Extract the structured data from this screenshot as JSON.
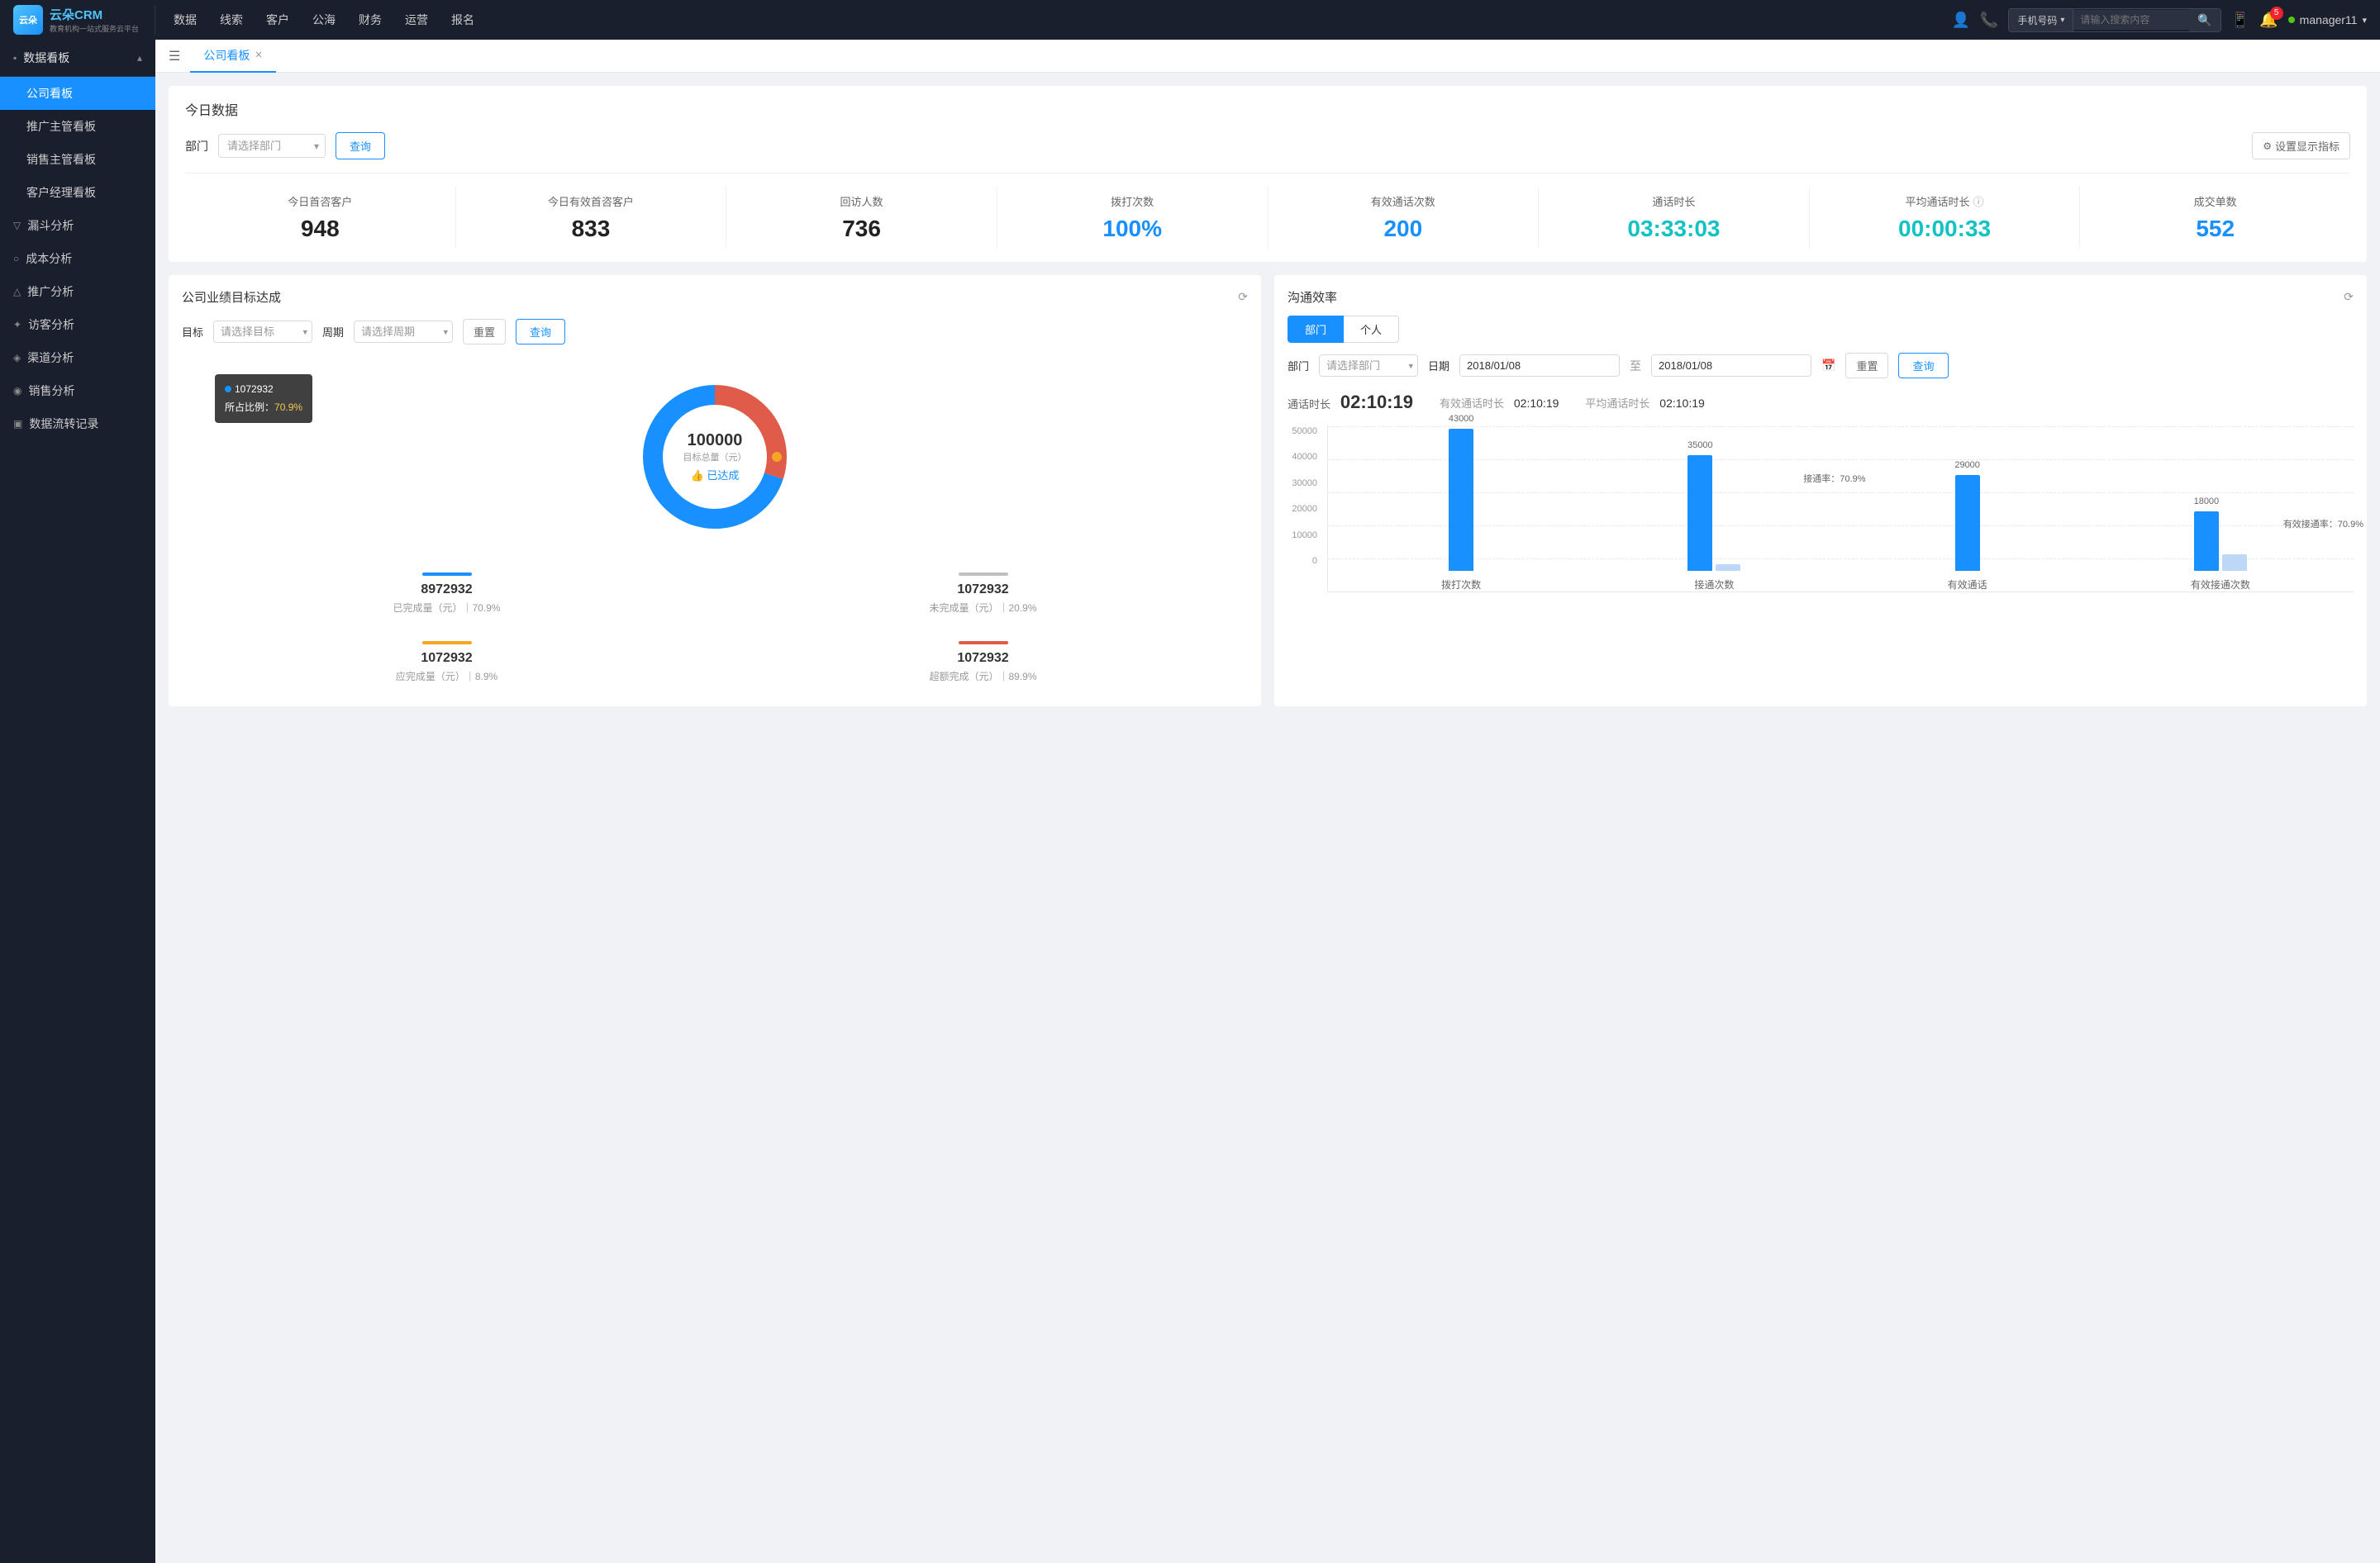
{
  "topNav": {
    "brand": "云朵CRM",
    "brandSub": "教育机构一站式服务云平台",
    "items": [
      "数据",
      "线索",
      "客户",
      "公海",
      "财务",
      "运营",
      "报名"
    ],
    "searchPlaceholder": "请输入搜索内容",
    "searchSelectLabel": "手机号码",
    "notificationCount": "5",
    "username": "manager11"
  },
  "sidebar": {
    "sectionLabel": "数据看板",
    "activeItem": "公司看板",
    "items": [
      "公司看板",
      "推广主管看板",
      "销售主管看板",
      "客户经理看板"
    ],
    "groups": [
      {
        "icon": "▽",
        "label": "漏斗分析"
      },
      {
        "icon": "○",
        "label": "成本分析"
      },
      {
        "icon": "△",
        "label": "推广分析"
      },
      {
        "icon": "✦",
        "label": "访客分析"
      },
      {
        "icon": "◈",
        "label": "渠道分析"
      },
      {
        "icon": "◉",
        "label": "销售分析"
      },
      {
        "icon": "▣",
        "label": "数据流转记录"
      }
    ]
  },
  "tabs": [
    {
      "label": "公司看板",
      "closable": true,
      "active": true
    }
  ],
  "todayData": {
    "title": "今日数据",
    "filterLabel": "部门",
    "filterPlaceholder": "请选择部门",
    "queryBtn": "查询",
    "settingsBtn": "设置显示指标",
    "metrics": [
      {
        "label": "今日首咨客户",
        "value": "948",
        "colorClass": "dark"
      },
      {
        "label": "今日有效首咨客户",
        "value": "833",
        "colorClass": "dark"
      },
      {
        "label": "回访人数",
        "value": "736",
        "colorClass": "dark"
      },
      {
        "label": "拨打次数",
        "value": "100%",
        "colorClass": "blue"
      },
      {
        "label": "有效通话次数",
        "value": "200",
        "colorClass": "blue"
      },
      {
        "label": "通话时长",
        "value": "03:33:03",
        "colorClass": "cyan"
      },
      {
        "label": "平均通话时长",
        "value": "00:00:33",
        "colorClass": "cyan"
      },
      {
        "label": "成交单数",
        "value": "552",
        "colorClass": "blue"
      }
    ]
  },
  "companyTarget": {
    "title": "公司业绩目标达成",
    "targetLabel": "目标",
    "targetPlaceholder": "请选择目标",
    "periodLabel": "周期",
    "periodPlaceholder": "请选择周期",
    "resetBtn": "重置",
    "queryBtn": "查询",
    "donut": {
      "centerValue": "100000",
      "centerLabel": "目标总量（元）",
      "achievedLabel": "👍 已达成",
      "tooltip": {
        "value": "1072932",
        "percentLabel": "所占比例：",
        "percent": "70.9%"
      }
    },
    "metrics": [
      {
        "color": "#1890ff",
        "value": "8972932",
        "label": "已完成量（元）｜70.9%",
        "barColor": "#1890ff"
      },
      {
        "color": "#c0c0c0",
        "value": "1072932",
        "label": "未完成量（元）｜20.9%",
        "barColor": "#c0c0c0"
      },
      {
        "color": "#f5a623",
        "value": "1072932",
        "label": "应完成量（元）｜8.9%",
        "barColor": "#f5a623"
      },
      {
        "color": "#e05c4a",
        "value": "1072932",
        "label": "超额完成（元）｜89.9%",
        "barColor": "#e05c4a"
      }
    ]
  },
  "commEfficiency": {
    "title": "沟通效率",
    "tabs": [
      "部门",
      "个人"
    ],
    "activeTab": "部门",
    "departmentLabel": "部门",
    "departmentPlaceholder": "请选择部门",
    "dateLabel": "日期",
    "dateFrom": "2018/01/08",
    "dateTo": "2018/01/08",
    "resetBtn": "重置",
    "queryBtn": "查询",
    "stats": {
      "mainLabel": "通话时长",
      "mainValue": "02:10:19",
      "effectiveLabel": "有效通话时长",
      "effectiveValue": "02:10:19",
      "avgLabel": "平均通话时长",
      "avgValue": "02:10:19"
    },
    "chart": {
      "yLabels": [
        "50000",
        "40000",
        "30000",
        "20000",
        "10000",
        "0"
      ],
      "groups": [
        {
          "xLabel": "拨打次数",
          "bars": [
            {
              "value": 43000,
              "height": 172,
              "label": "43000",
              "type": "blue"
            },
            {
              "value": 0,
              "height": 0,
              "label": "",
              "type": "light"
            }
          ]
        },
        {
          "xLabel": "接通次数",
          "bars": [
            {
              "value": 35000,
              "height": 140,
              "label": "35000",
              "type": "blue"
            },
            {
              "value": 0,
              "height": 0,
              "label": "",
              "type": "light"
            }
          ],
          "rateLabel": "接通率：70.9%"
        },
        {
          "xLabel": "有效通话",
          "bars": [
            {
              "value": 29000,
              "height": 116,
              "label": "29000",
              "type": "blue"
            },
            {
              "value": 0,
              "height": 0,
              "label": "",
              "type": "light"
            }
          ]
        },
        {
          "xLabel": "有效接通次数",
          "bars": [
            {
              "value": 18000,
              "height": 72,
              "label": "18000",
              "type": "blue"
            },
            {
              "value": 0,
              "height": 6,
              "label": "",
              "type": "light"
            }
          ],
          "rateLabel": "有效接通率：70.9%"
        }
      ]
    }
  }
}
